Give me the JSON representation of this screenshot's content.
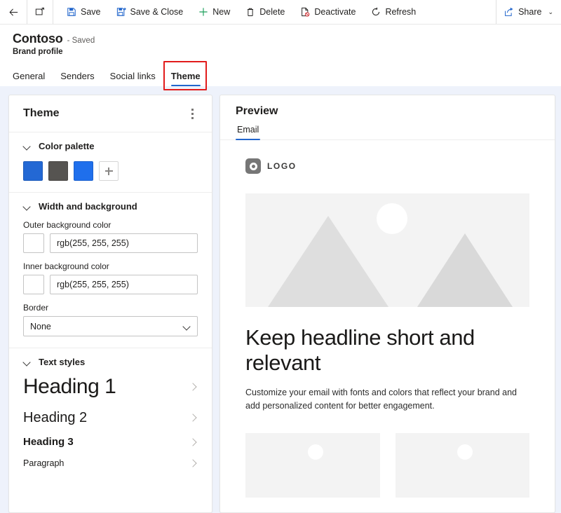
{
  "commandbar": {
    "back_label": "Back",
    "popout_label": "Open in new window",
    "items": [
      {
        "label": "Save",
        "icon": "save-icon"
      },
      {
        "label": "Save & Close",
        "icon": "save-and-close-icon"
      },
      {
        "label": "New",
        "icon": "plus-icon"
      },
      {
        "label": "Delete",
        "icon": "trash-icon"
      },
      {
        "label": "Deactivate",
        "icon": "deactivate-icon"
      },
      {
        "label": "Refresh",
        "icon": "refresh-icon"
      }
    ],
    "share": {
      "label": "Share",
      "icon": "share-icon",
      "chevron": "⌄"
    }
  },
  "record": {
    "title": "Contoso",
    "saved_status": "- Saved",
    "entity": "Brand profile"
  },
  "tabs": {
    "items": [
      {
        "label": "General",
        "active": false
      },
      {
        "label": "Senders",
        "active": false
      },
      {
        "label": "Social links",
        "active": false
      },
      {
        "label": "Theme",
        "active": true
      }
    ],
    "highlight_color": "#e21b1b",
    "active_underline_color": "#2266cc"
  },
  "theme_panel": {
    "title": "Theme",
    "more_options_label": "More options",
    "sections": {
      "color_palette": {
        "label": "Color palette",
        "expanded": true,
        "swatches": [
          "#2368d4",
          "#565451",
          "#1f6fec"
        ],
        "add_label": "Add color"
      },
      "width_and_background": {
        "label": "Width and background",
        "expanded": true,
        "fields": [
          {
            "label": "Outer background color",
            "value": "rgb(255, 255, 255)",
            "chip_color": "#ffffff"
          },
          {
            "label": "Inner background color",
            "value": "rgb(255, 255, 255)",
            "chip_color": "#ffffff"
          }
        ],
        "border": {
          "label": "Border",
          "value": "None",
          "options": [
            "None"
          ]
        }
      },
      "text_styles": {
        "label": "Text styles",
        "expanded": true,
        "styles": [
          {
            "label": "Heading 1"
          },
          {
            "label": "Heading 2"
          },
          {
            "label": "Heading 3"
          },
          {
            "label": "Paragraph"
          }
        ]
      }
    }
  },
  "preview_panel": {
    "title": "Preview",
    "tabs": [
      {
        "label": "Email",
        "active": true
      }
    ],
    "email": {
      "logo_text": "LOGO",
      "hero_alt": "mountain-placeholder-image",
      "headline": "Keep headline short and relevant",
      "body": "Customize your email with fonts and colors that reflect your brand and add personalized content for better engagement.",
      "cards": [
        {
          "image_alt": "placeholder-image"
        },
        {
          "image_alt": "placeholder-image"
        }
      ]
    }
  }
}
